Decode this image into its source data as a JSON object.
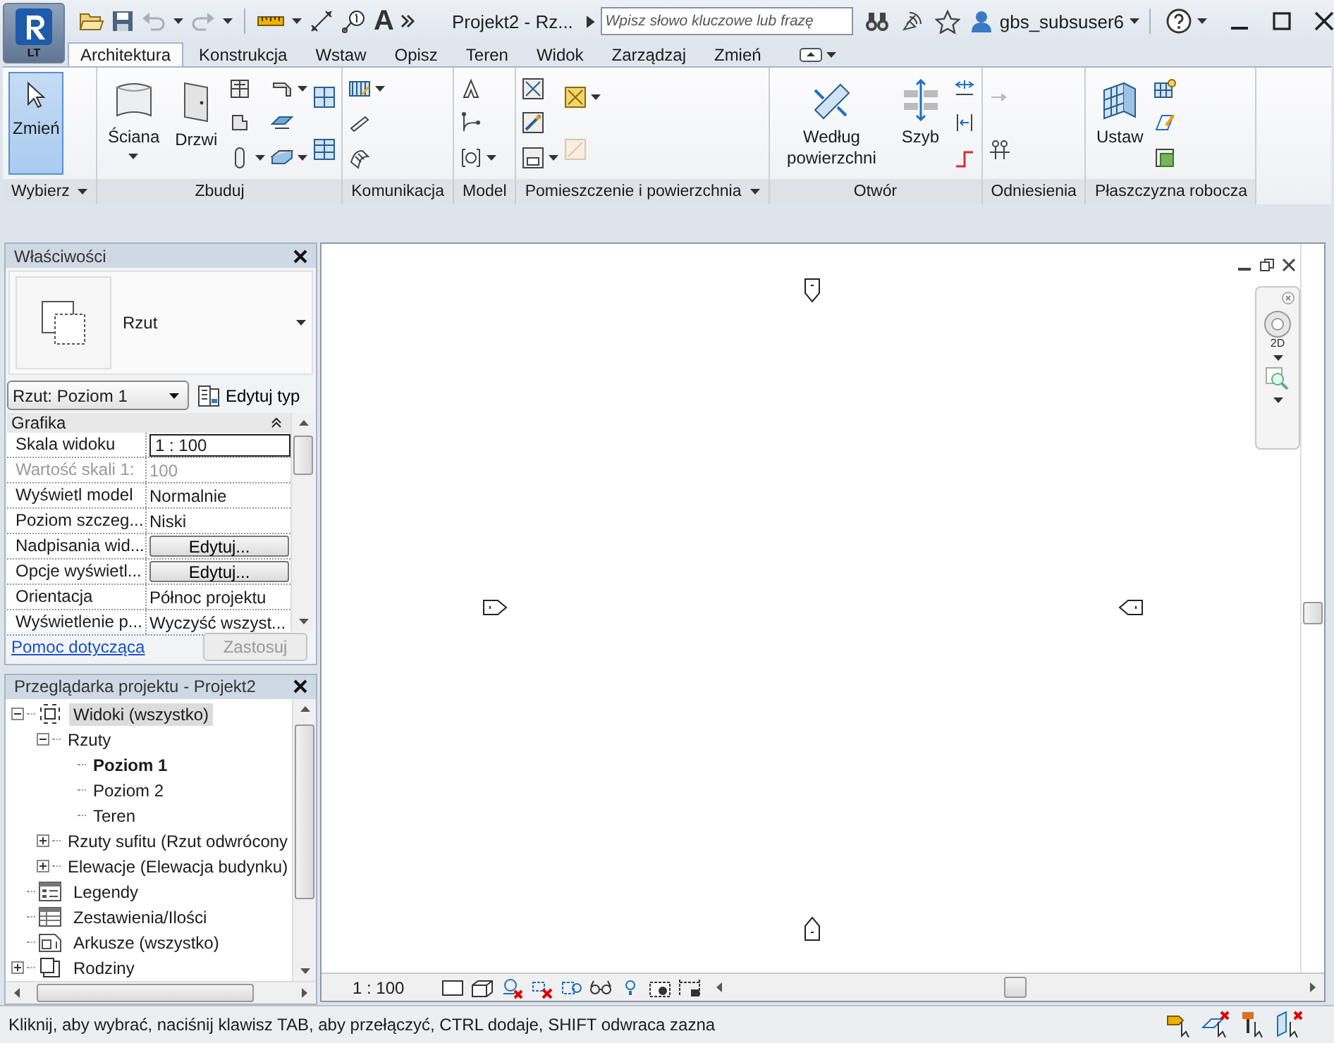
{
  "app_button": {
    "label": "LT"
  },
  "title_bar": {
    "text_tool": "A",
    "title": "Projekt2 - Rz...",
    "search": {
      "placeholder": "Wpisz słowo kluczowe lub frazę"
    },
    "user": "gbs_subsuser6"
  },
  "tabs": [
    {
      "label": "Architektura",
      "selected": true
    },
    {
      "label": "Konstrukcja",
      "selected": false
    },
    {
      "label": "Wstaw",
      "selected": false
    },
    {
      "label": "Opisz",
      "selected": false
    },
    {
      "label": "Teren",
      "selected": false
    },
    {
      "label": "Widok",
      "selected": false
    },
    {
      "label": "Zarządzaj",
      "selected": false
    },
    {
      "label": "Zmień",
      "selected": false
    }
  ],
  "ribbon": {
    "panels": [
      {
        "label": "Wybierz",
        "menu": true,
        "tools": [
          {
            "label": "Zmień",
            "selected": true,
            "menu": false
          }
        ]
      },
      {
        "label": "Zbuduj",
        "menu": false,
        "tools": [
          {
            "label": "Ściana",
            "selected": false,
            "menu": true
          },
          {
            "label": "Drzwi",
            "selected": false,
            "menu": false
          }
        ]
      },
      {
        "label": "Komunikacja",
        "menu": false
      },
      {
        "label": "Model",
        "menu": false
      },
      {
        "label": "Pomieszczenie i powierzchnia",
        "menu": true
      },
      {
        "label": "Otwór",
        "menu": false,
        "tools": [
          {
            "label": "Według powierzchni",
            "selected": false,
            "menu": false
          },
          {
            "label": "Szyb",
            "selected": false,
            "menu": false
          }
        ]
      },
      {
        "label": "Odniesienia",
        "menu": false
      },
      {
        "label": "Płaszczyzna robocza",
        "menu": false,
        "tools": [
          {
            "label": "Ustaw",
            "selected": false,
            "menu": false
          }
        ]
      }
    ]
  },
  "properties": {
    "title": "Właściwości",
    "type_name": "Rzut",
    "selector": "Rzut: Poziom 1",
    "edit_type": "Edytuj typ",
    "group": "Grafika",
    "rows": [
      {
        "name": "Skala widoku",
        "value": "1 : 100",
        "kind": "field",
        "disabled": false
      },
      {
        "name": "Wartość skali  1:",
        "value": "100",
        "kind": "text",
        "disabled": true
      },
      {
        "name": "Wyświetl model",
        "value": "Normalnie",
        "kind": "text",
        "disabled": false
      },
      {
        "name": "Poziom szczeg...",
        "value": "Niski",
        "kind": "text",
        "disabled": false
      },
      {
        "name": "Nadpisania wid...",
        "value": "Edytuj...",
        "kind": "button",
        "disabled": false
      },
      {
        "name": "Opcje wyświetl...",
        "value": "Edytuj...",
        "kind": "button",
        "disabled": false
      },
      {
        "name": "Orientacja",
        "value": "Północ projektu",
        "kind": "text",
        "disabled": false
      },
      {
        "name": "Wyświetlenie p...",
        "value": "Wyczyść wszyst...",
        "kind": "text",
        "disabled": false
      }
    ],
    "help_link": "Pomoc dotycząca",
    "apply": {
      "label": "Zastosuj",
      "disabled": true
    }
  },
  "project_browser": {
    "title": "Przeglądarka projektu - Projekt2",
    "tree": [
      {
        "label": "Widoki (wszystko)",
        "kind": "views",
        "selected": true,
        "active": false,
        "expanded": true,
        "children": [
          {
            "label": "Rzuty",
            "selected": false,
            "active": false,
            "expanded": true,
            "children": [
              {
                "label": "Poziom 1",
                "selected": false,
                "active": true
              },
              {
                "label": "Poziom 2",
                "selected": false,
                "active": false
              },
              {
                "label": "Teren",
                "selected": false,
                "active": false
              }
            ]
          },
          {
            "label": "Rzuty sufitu (Rzut odwrócony",
            "selected": false,
            "active": false,
            "expanded": false
          },
          {
            "label": "Elewacje (Elewacja budynku)",
            "selected": false,
            "active": false,
            "expanded": false
          }
        ]
      },
      {
        "label": "Legendy",
        "kind": "legend",
        "selected": false,
        "active": false
      },
      {
        "label": "Zestawienia/Ilości",
        "kind": "schedule",
        "selected": false,
        "active": false
      },
      {
        "label": "Arkusze (wszystko)",
        "kind": "sheet",
        "selected": false,
        "active": false
      },
      {
        "label": "Rodziny",
        "kind": "family",
        "selected": false,
        "active": false,
        "expanded": false
      }
    ]
  },
  "view": {
    "nav_label": "2D",
    "scale": "1 : 100"
  },
  "status_bar": {
    "text": "Kliknij, aby wybrać, naciśnij klawisz TAB, aby przełączyć, CTRL dodaje, SHIFT odwraca zazna"
  }
}
